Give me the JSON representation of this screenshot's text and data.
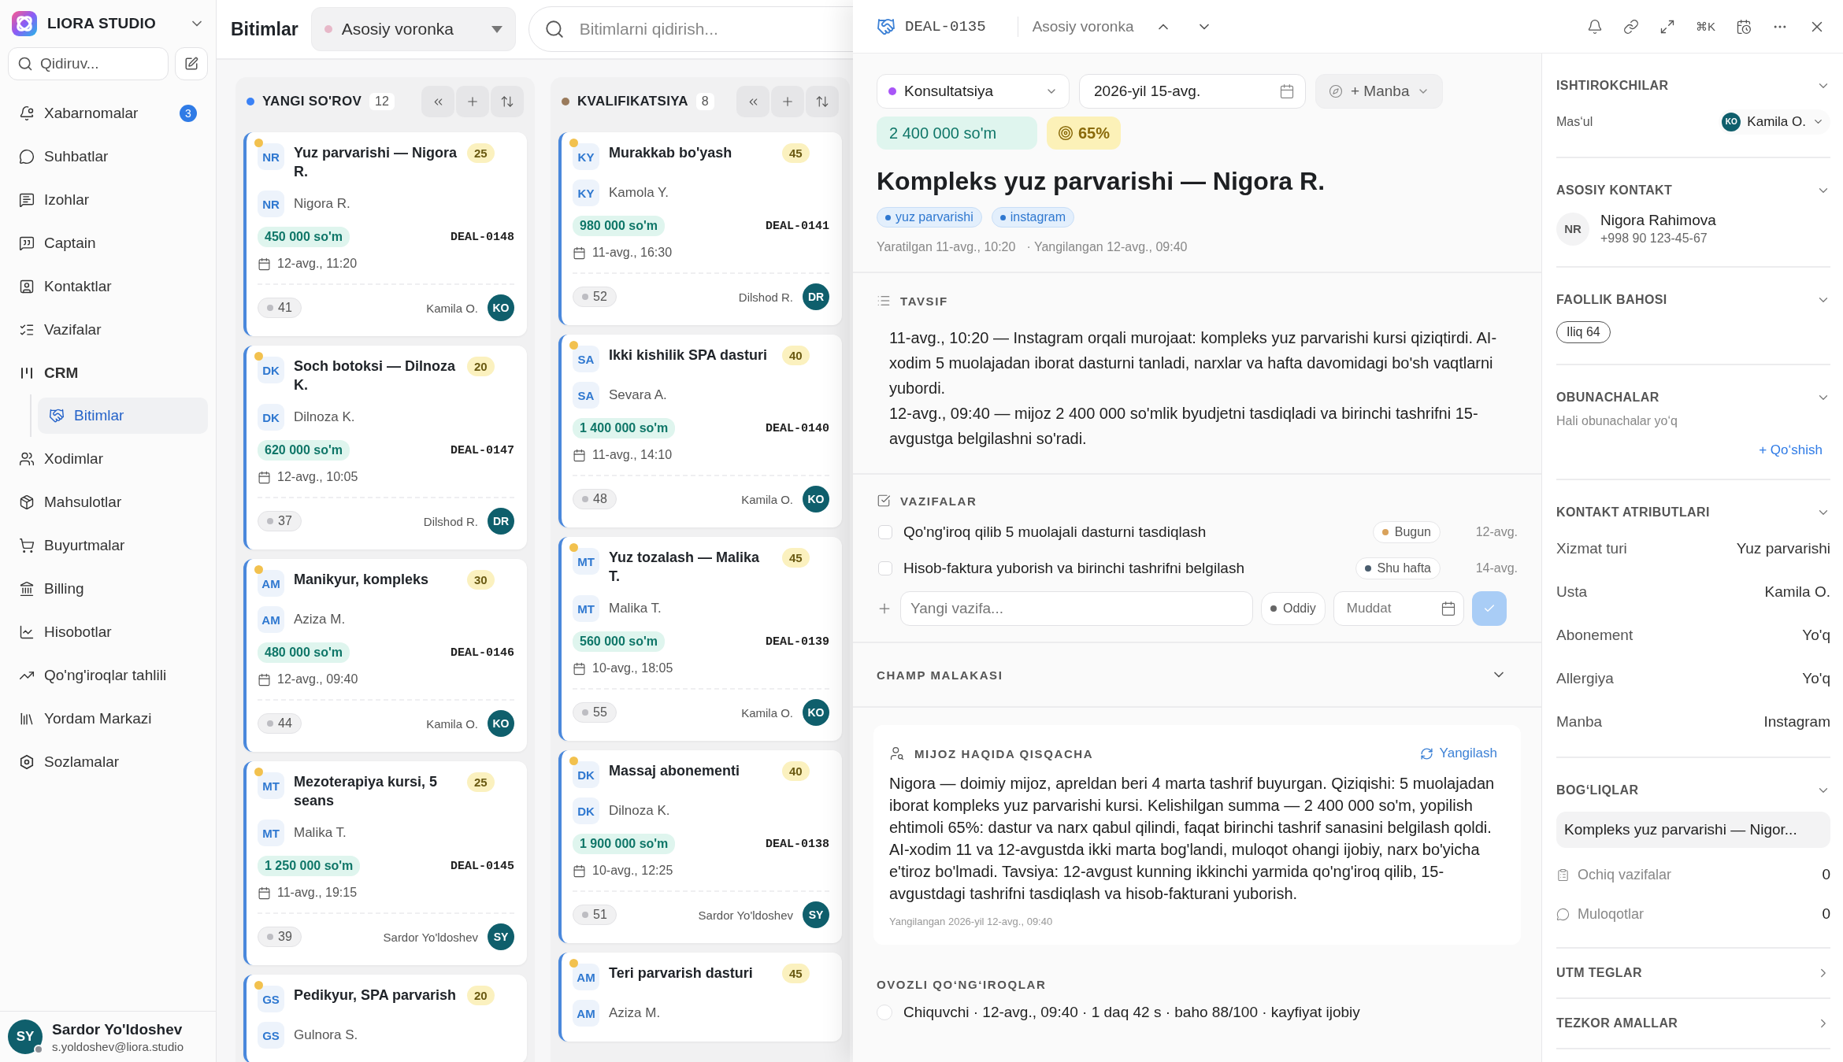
{
  "sidebar": {
    "workspace": "LIORA STUDIO",
    "search": {
      "placeholder": "Qidiruv..."
    },
    "items": [
      {
        "label": "Xabarnomalar",
        "badge": "3",
        "selected": false
      },
      {
        "label": "Suhbatlar",
        "selected": false
      },
      {
        "label": "Izohlar",
        "selected": false
      },
      {
        "label": "Captain",
        "selected": false
      },
      {
        "label": "Kontaktlar",
        "selected": false
      },
      {
        "label": "Vazifalar",
        "selected": false
      },
      {
        "label": "CRM",
        "selected": false,
        "expanded": true,
        "children": [
          {
            "label": "Bitimlar",
            "selected": true
          }
        ]
      },
      {
        "label": "Xodimlar",
        "selected": false
      },
      {
        "label": "Mahsulotlar",
        "selected": false
      },
      {
        "label": "Buyurtmalar",
        "selected": false
      },
      {
        "label": "Billing",
        "selected": false
      },
      {
        "label": "Hisobotlar",
        "selected": false
      },
      {
        "label": "Qo'ng'iroqlar tahlili",
        "selected": false
      },
      {
        "label": "Yordam Markazi",
        "selected": false
      },
      {
        "label": "Sozlamalar",
        "selected": false
      }
    ],
    "user": {
      "initials": "SY",
      "name": "Sardor Yo'ldoshev",
      "email": "s.yoldoshev@liora.studio",
      "online": false
    }
  },
  "board": {
    "title": "Bitimlar",
    "pipeline": "Asosiy voronka",
    "search": {
      "placeholder": "Bitimlarni qidirish..."
    },
    "columns": [
      {
        "title": "YANGI SO'ROV",
        "count": "12",
        "color": "#3b82f6",
        "cards": [
          {
            "title": "Yuz parvarishi — Nigora R.",
            "score": "25",
            "initials": "NR",
            "contact_initials": "NR",
            "contact": "Nigora R.",
            "amount": "450 000 so'm",
            "deal_id": "DEAL-0148",
            "date": "12-avg., 11:20",
            "count": "41",
            "owner": "Kamila O.",
            "owner_initials": "KO"
          },
          {
            "title": "Soch botoksi — Dilnoza K.",
            "score": "20",
            "initials": "DK",
            "contact_initials": "DK",
            "contact": "Dilnoza K.",
            "amount": "620 000 so'm",
            "deal_id": "DEAL-0147",
            "date": "12-avg., 10:05",
            "count": "37",
            "owner": "Dilshod R.",
            "owner_initials": "DR"
          },
          {
            "title": "Manikyur, kompleks",
            "score": "30",
            "initials": "AM",
            "contact_initials": "AM",
            "contact": "Aziza M.",
            "amount": "480 000 so'm",
            "deal_id": "DEAL-0146",
            "date": "12-avg., 09:40",
            "count": "44",
            "owner": "Kamila O.",
            "owner_initials": "KO"
          },
          {
            "title": "Mezoterapiya kursi, 5 seans",
            "score": "25",
            "initials": "MT",
            "contact_initials": "MT",
            "contact": "Malika T.",
            "amount": "1 250 000 so'm",
            "deal_id": "DEAL-0145",
            "date": "11-avg., 19:15",
            "count": "39",
            "owner": "Sardor Yo'ldoshev",
            "owner_initials": "SY"
          },
          {
            "title": "Pedikyur, SPA parvarish",
            "score": "20",
            "initials": "GS",
            "contact_initials": "GS",
            "contact": "Gulnora S."
          }
        ]
      },
      {
        "title": "KVALIFIKATSIYA",
        "count": "8",
        "color": "#9a7b5c",
        "cards": [
          {
            "title": "Murakkab bo'yash",
            "score": "45",
            "initials": "KY",
            "contact_initials": "KY",
            "contact": "Kamola Y.",
            "amount": "980 000 so'm",
            "deal_id": "DEAL-0141",
            "date": "11-avg., 16:30",
            "count": "52",
            "owner": "Dilshod R.",
            "owner_initials": "DR"
          },
          {
            "title": "Ikki kishilik SPA dasturi",
            "score": "40",
            "initials": "SA",
            "contact_initials": "SA",
            "contact": "Sevara A.",
            "amount": "1 400 000 so'm",
            "deal_id": "DEAL-0140",
            "date": "11-avg., 14:10",
            "count": "48",
            "owner": "Kamila O.",
            "owner_initials": "KO"
          },
          {
            "title": "Yuz tozalash — Malika T.",
            "score": "45",
            "initials": "MT",
            "contact_initials": "MT",
            "contact": "Malika T.",
            "amount": "560 000 so'm",
            "deal_id": "DEAL-0139",
            "date": "10-avg., 18:05",
            "count": "55",
            "owner": "Kamila O.",
            "owner_initials": "KO"
          },
          {
            "title": "Massaj abonementi",
            "score": "40",
            "initials": "DK",
            "contact_initials": "DK",
            "contact": "Dilnoza K.",
            "amount": "1 900 000 so'm",
            "deal_id": "DEAL-0138",
            "date": "10-avg., 12:25",
            "count": "51",
            "owner": "Sardor Yo'ldoshev",
            "owner_initials": "SY"
          },
          {
            "title": "Teri parvarish dasturi",
            "score": "45",
            "initials": "AM",
            "contact_initials": "AM",
            "contact": "Aziza M."
          }
        ]
      }
    ]
  },
  "deal": {
    "id": "DEAL-0135",
    "pipeline": "Asosiy voronka",
    "shortcut": "⌘K",
    "stage": {
      "label": "Konsultatsiya",
      "color": "#a855f7"
    },
    "close_date": "2026-yil 15-avg.",
    "source_button": "+ Manba",
    "amount": "2 400 000 so'm",
    "probability": "65%",
    "title": "Kompleks yuz parvarishi — Nigora R.",
    "tags": [
      "yuz parvarishi",
      "instagram"
    ],
    "created": "Yaratilgan 11-avg., 10:20",
    "updated": "· Yangilangan 12-avg., 09:40",
    "description": {
      "title": "TAVSIF",
      "paragraphs": [
        "11-avg., 10:20 — Instagram orqali murojaat: kompleks yuz parvarishi kursi qiziqtirdi. AI-xodim 5 muolajadan iborat dasturni tanladi, narxlar va hafta davomidagi bo'sh vaqtlarni yubordi.",
        "12-avg., 09:40 — mijoz 2 400 000 so'mlik byudjetni tasdiqladi va birinchi tashrifni 15-avgustga belgilashni so'radi."
      ]
    },
    "tasks": {
      "title": "VAZIFALAR",
      "items": [
        {
          "title": "Qo'ng'iroq qilib 5 muolajali dasturni tasdiqlash",
          "checked": false,
          "priority": "Bugun",
          "color": "#d9a25b",
          "due": "12-avg."
        },
        {
          "title": "Hisob-faktura yuborish va birinchi tashrifni belgilash",
          "checked": false,
          "priority": "Shu hafta",
          "color": "#4a5d6e",
          "due": "14-avg."
        }
      ],
      "new_task": {
        "placeholder": "Yangi vazifa...",
        "priority": "Oddiy",
        "due_placeholder": "Muddat"
      }
    },
    "champ": {
      "title": "CHAMP MALAKASI",
      "expanded": true,
      "summary": {
        "title": "MIJOZ HAQIDA QISQACHA",
        "action": "Yangilash",
        "text": "Nigora — doimiy mijoz, apreldan beri 4 marta tashrif buyurgan. Qiziqishi: 5 muolajadan iborat kompleks yuz parvarishi kursi. Kelishilgan summa — 2 400 000 so'm, yopilish ehtimoli 65%: dastur va narx qabul qilindi, faqat birinchi tashrif sanasini belgilash qoldi. AI-xodim 11 va 12-avgustda ikki marta bog'landi, muloqot ohangi ijobiy, narx bo'yicha e'tiroz bo'lmadi. Tavsiya: 12-avgust kunning ikkinchi yarmida qo'ng'iroq qilib, 15-avgustdagi tashrifni tasdiqlash va hisob-fakturani yuborish.",
        "updated": "Yangilangan 2026-yil 12-avg., 09:40"
      }
    },
    "calls": {
      "title": "OVOZLI QO‘NG‘IROQLAR",
      "items": [
        {
          "text": "Chiquvchi · 12-avg., 09:40 · 1 daq 42 s · baho 88/100 · kayfiyat ijobiy",
          "checked": false
        }
      ]
    }
  },
  "side_panel": {
    "sections": [
      {
        "kind": "participants",
        "title": "ISHTIROKCHILAR",
        "expanded": true,
        "label": "Mas‘ul",
        "owner": "Kamila O.",
        "owner_initials": "KO"
      },
      {
        "kind": "contact",
        "title": "ASOSIY KONTAKT",
        "expanded": true,
        "initials": "NR",
        "name": "Nigora Rahimova",
        "phone": "+998 90 123-45-67"
      },
      {
        "kind": "score",
        "title": "FAOLLIK BAHOSI",
        "expanded": true,
        "value": "Iliq 64"
      },
      {
        "kind": "followers",
        "title": "OBUNACHALAR",
        "expanded": true,
        "empty": "Hali obunachalar yo‘q",
        "action": "+ Qo‘shish"
      },
      {
        "kind": "attributes",
        "title": "KONTAKT ATRIBUTLARI",
        "expanded": true,
        "rows": [
          {
            "label": "Xizmat turi",
            "value": "Yuz parvarishi"
          },
          {
            "label": "Usta",
            "value": "Kamila O."
          },
          {
            "label": "Abonement",
            "value": "Yo'q"
          },
          {
            "label": "Allergiya",
            "value": "Yo'q"
          },
          {
            "label": "Manba",
            "value": "Instagram"
          }
        ]
      },
      {
        "kind": "links",
        "title": "BOG‘LIQLAR",
        "expanded": true,
        "deal": "Kompleks yuz parvarishi — Nigor...",
        "rows": [
          {
            "label": "Ochiq vazifalar",
            "value": "0"
          },
          {
            "label": "Muloqotlar",
            "value": "0"
          }
        ]
      },
      {
        "kind": "plain",
        "title": "UTM TEGLAR",
        "expanded": false
      },
      {
        "kind": "plain",
        "title": "TEZKOR AMALLAR",
        "expanded": false
      }
    ]
  }
}
